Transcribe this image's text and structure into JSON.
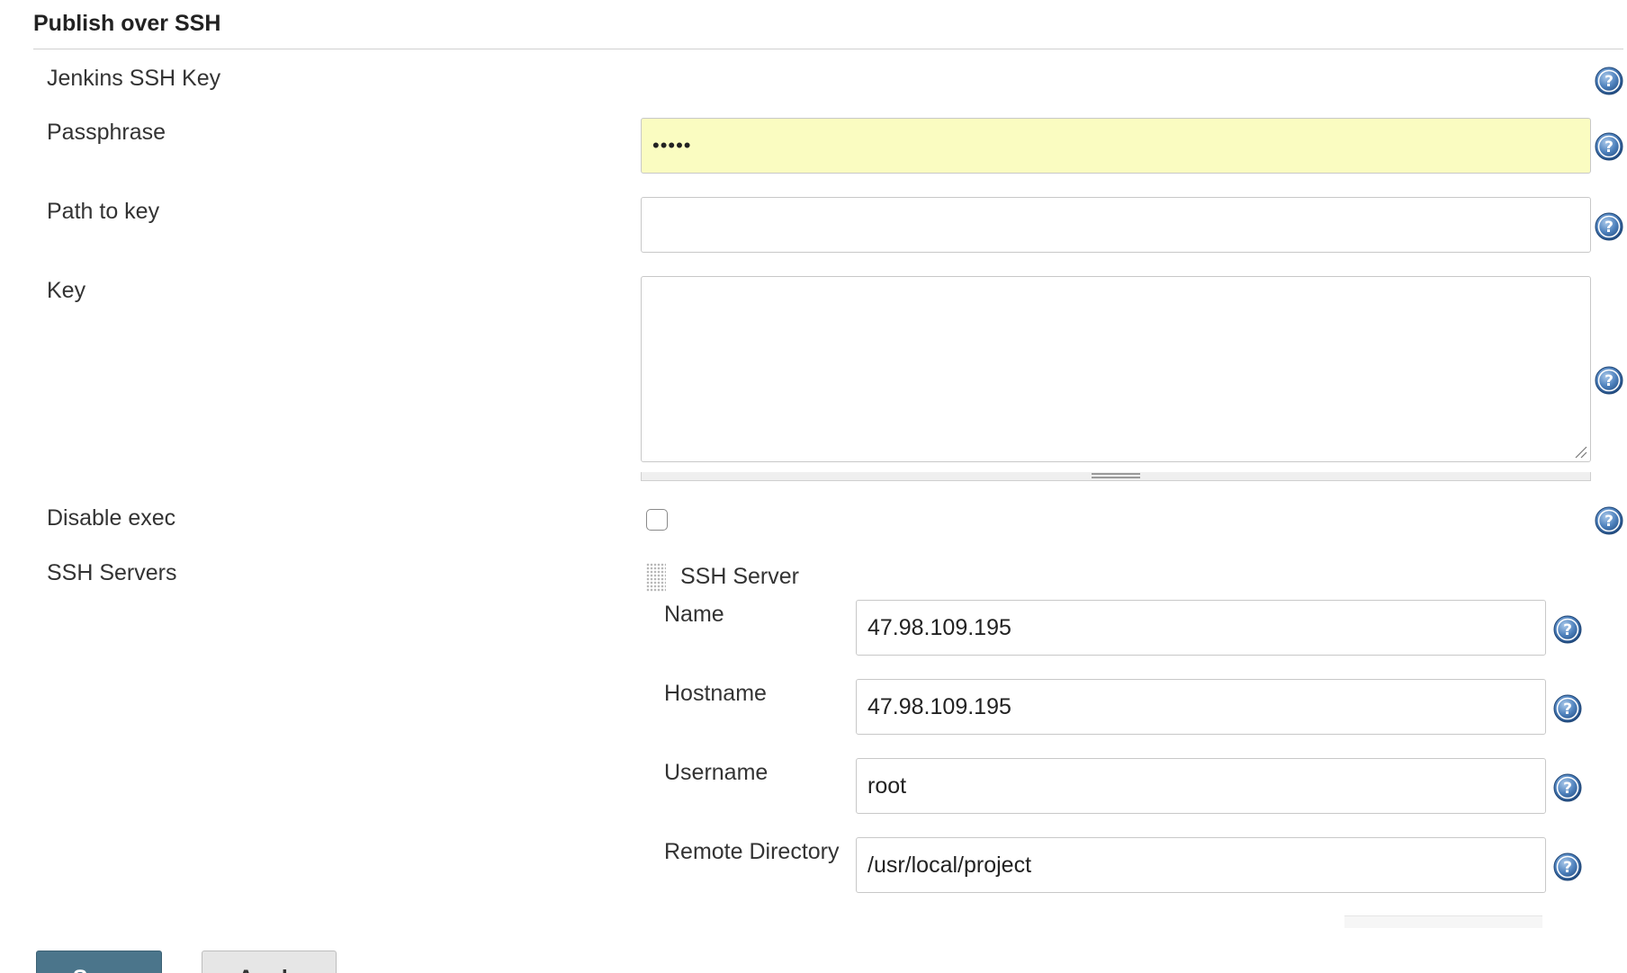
{
  "section": {
    "title": "Publish over SSH"
  },
  "fields": {
    "jenkins_ssh_key": {
      "label": "Jenkins SSH Key"
    },
    "passphrase": {
      "label": "Passphrase",
      "value": "•••••"
    },
    "path_to_key": {
      "label": "Path to key",
      "value": ""
    },
    "key": {
      "label": "Key",
      "value": ""
    },
    "disable_exec": {
      "label": "Disable exec",
      "checked": false
    },
    "ssh_servers": {
      "label": "SSH Servers"
    }
  },
  "ssh_server": {
    "title": "SSH Server",
    "name": {
      "label": "Name",
      "value": "47.98.109.195"
    },
    "hostname": {
      "label": "Hostname",
      "value": "47.98.109.195"
    },
    "username": {
      "label": "Username",
      "value": "root"
    },
    "remote_directory": {
      "label": "Remote Directory",
      "value": "/usr/local/project"
    }
  },
  "buttons": {
    "save": "Save",
    "apply": "Apply"
  },
  "colors": {
    "help_icon": "#3a6ea5",
    "autofill_bg": "#fafcc1",
    "primary_button": "#4b758b"
  }
}
